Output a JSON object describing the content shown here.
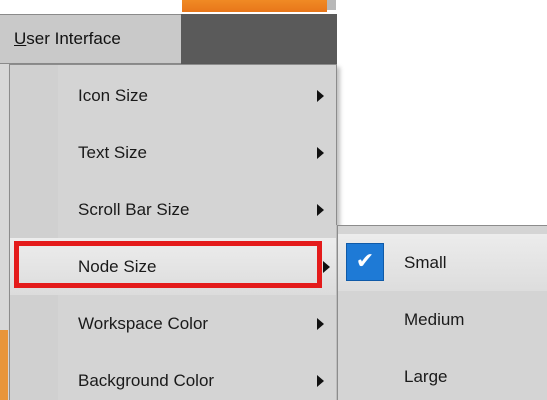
{
  "menu_bar": {
    "title_mnemonic": "U",
    "title_rest": "ser Interface"
  },
  "dropdown": {
    "items": [
      {
        "label": "Icon Size",
        "has_submenu": true,
        "highlighted": false
      },
      {
        "label": "Text Size",
        "has_submenu": true,
        "highlighted": false
      },
      {
        "label": "Scroll Bar Size",
        "has_submenu": true,
        "highlighted": false
      },
      {
        "label": "Node Size",
        "has_submenu": true,
        "highlighted": true
      },
      {
        "label": "Workspace Color",
        "has_submenu": true,
        "highlighted": false
      },
      {
        "label": "Background Color",
        "has_submenu": true,
        "highlighted": false
      }
    ]
  },
  "submenu": {
    "items": [
      {
        "label": "Small",
        "checked": true
      },
      {
        "label": "Medium",
        "checked": false
      },
      {
        "label": "Large",
        "checked": false
      }
    ],
    "check_glyph": "✔"
  },
  "colors": {
    "highlight_border": "#e41b1b",
    "check_accent": "#1e7ad6",
    "menu_bg": "#d4d4d4"
  },
  "icons": {
    "submenu_arrow": "chevron-right-icon",
    "checkmark": "check-icon"
  }
}
